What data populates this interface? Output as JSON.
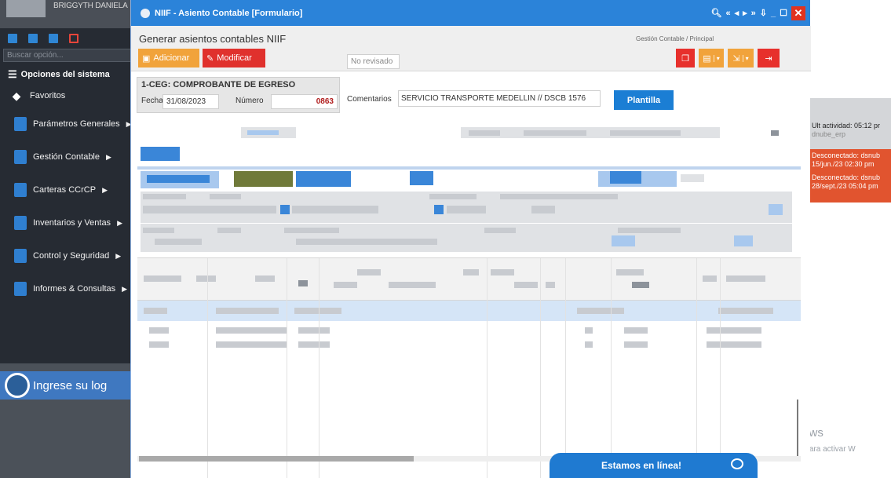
{
  "sidebar": {
    "user_name": "BRIGGYTH DANIELA",
    "search_placeholder": "Buscar opción...",
    "options_title": "Opciones del sistema",
    "favorites": "Favoritos",
    "items": [
      {
        "label": "Parámetros Generales",
        "icon": "settings-icon"
      },
      {
        "label": "Gestión Contable",
        "icon": "accounting-icon"
      },
      {
        "label": "Carteras CCrCP",
        "icon": "database-icon"
      },
      {
        "label": "Inventarios y Ventas",
        "icon": "inventory-icon"
      },
      {
        "label": "Control y Seguridad",
        "icon": "security-icon"
      },
      {
        "label": "Informes & Consultas",
        "icon": "reports-icon"
      }
    ],
    "login_text": "Ingrese su log"
  },
  "window": {
    "title": "NIIF - Asiento Contable [Formulario]",
    "form_title": "Generar asientos contables NIIF",
    "breadcrumb": "Gestión Contable / Principal",
    "add_label": "Adicionar",
    "edit_label": "Modificar",
    "review_status": "No revisado",
    "template_label": "Plantilla"
  },
  "document": {
    "title": "1-CEG: COMPROBANTE DE EGRESO",
    "date_label": "Fecha",
    "date_value": "31/08/2023",
    "number_label": "Número",
    "number_value": "0863",
    "comments_label": "Comentarios",
    "comments_value": "SERVICIO TRANSPORTE MEDELLIN // DSCB 1576"
  },
  "right_panel": {
    "last_activity": "Ult actividad: 05:12 pr",
    "last_user": "dnube_erp",
    "disconnected_1": "Desconectado: dsnub",
    "disconnected_1_time": "15/jun./23 02:30 pm",
    "disconnected_2": "Desconectado: dsnub",
    "disconnected_2_time": "28/sept./23 05:04 pm"
  },
  "windows_watermark": {
    "title": "Activar Windows",
    "subtitle": "Ve a Configuración para activar W"
  },
  "chat": {
    "label": "Estamos en línea!"
  },
  "colors": {
    "title_bar": "#2b83d9",
    "sidebar": "#262b33",
    "accent_orange": "#f1a33b",
    "accent_red": "#e0312d"
  }
}
